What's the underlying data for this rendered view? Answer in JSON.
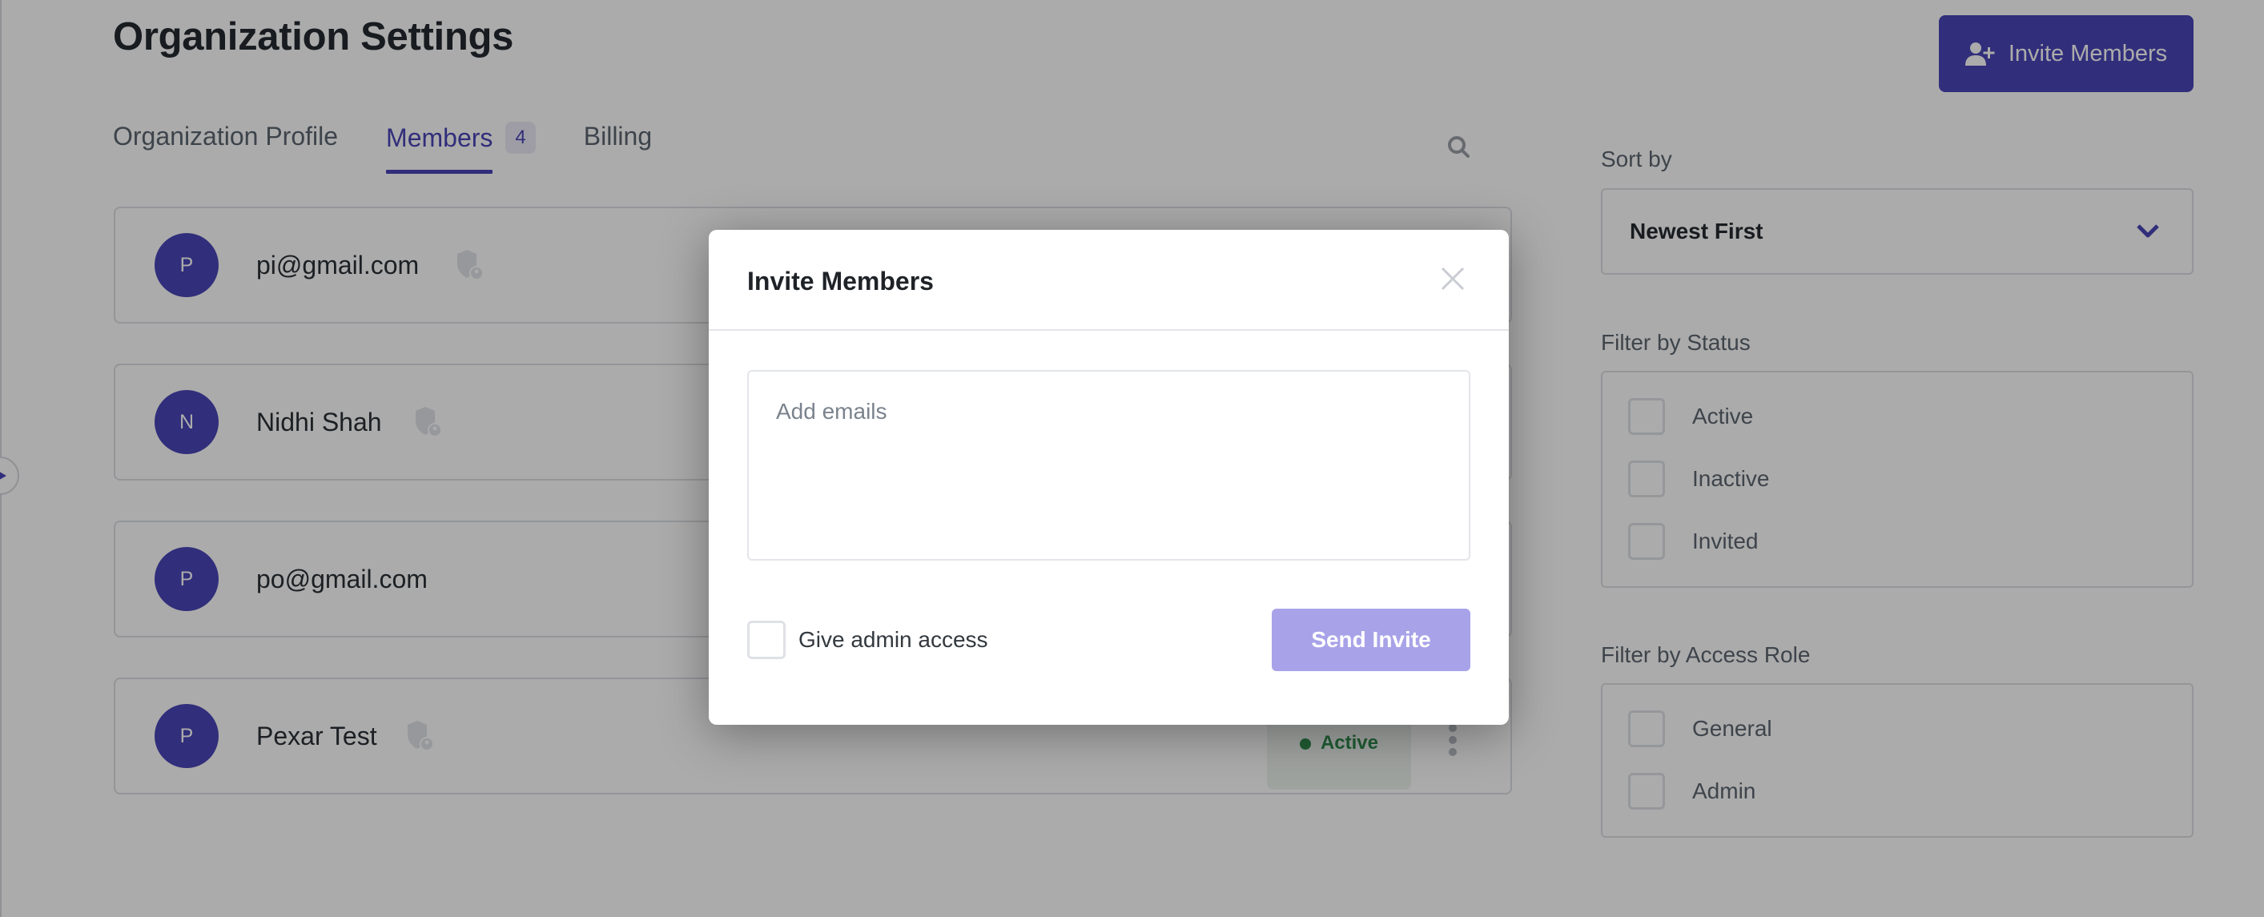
{
  "page": {
    "title": "Organization Settings",
    "tabs": [
      {
        "label": "Organization Profile",
        "active": false
      },
      {
        "label": "Members",
        "active": true,
        "badge": "4"
      },
      {
        "label": "Billing",
        "active": false
      }
    ],
    "search_icon": "search-icon",
    "invite_button": {
      "label": "Invite Members",
      "icon": "user-plus-icon"
    }
  },
  "members": [
    {
      "initial": "P",
      "name": "pi@gmail.com",
      "admin_shield": true,
      "status": null
    },
    {
      "initial": "N",
      "name": "Nidhi Shah",
      "admin_shield": true,
      "status": null
    },
    {
      "initial": "P",
      "name": "po@gmail.com",
      "admin_shield": false,
      "status": null
    },
    {
      "initial": "P",
      "name": "Pexar Test",
      "admin_shield": true,
      "status": "Active"
    }
  ],
  "sidebar": {
    "sort": {
      "label": "Sort by",
      "selected": "Newest First"
    },
    "status_filter": {
      "label": "Filter by Status",
      "options": [
        "Active",
        "Inactive",
        "Invited"
      ]
    },
    "role_filter": {
      "label": "Filter by Access Role",
      "options": [
        "General",
        "Admin"
      ]
    }
  },
  "modal": {
    "title": "Invite Members",
    "email_input": {
      "placeholder": "Add emails",
      "value": ""
    },
    "admin_checkbox": {
      "label": "Give admin access",
      "checked": false
    },
    "send_button": "Send Invite"
  },
  "colors": {
    "accent": "#4a45b8",
    "accent_disabled": "#a8a3e8",
    "status_active": "#2f8a4c",
    "overlay": "rgba(0,0,0,0.33)"
  }
}
